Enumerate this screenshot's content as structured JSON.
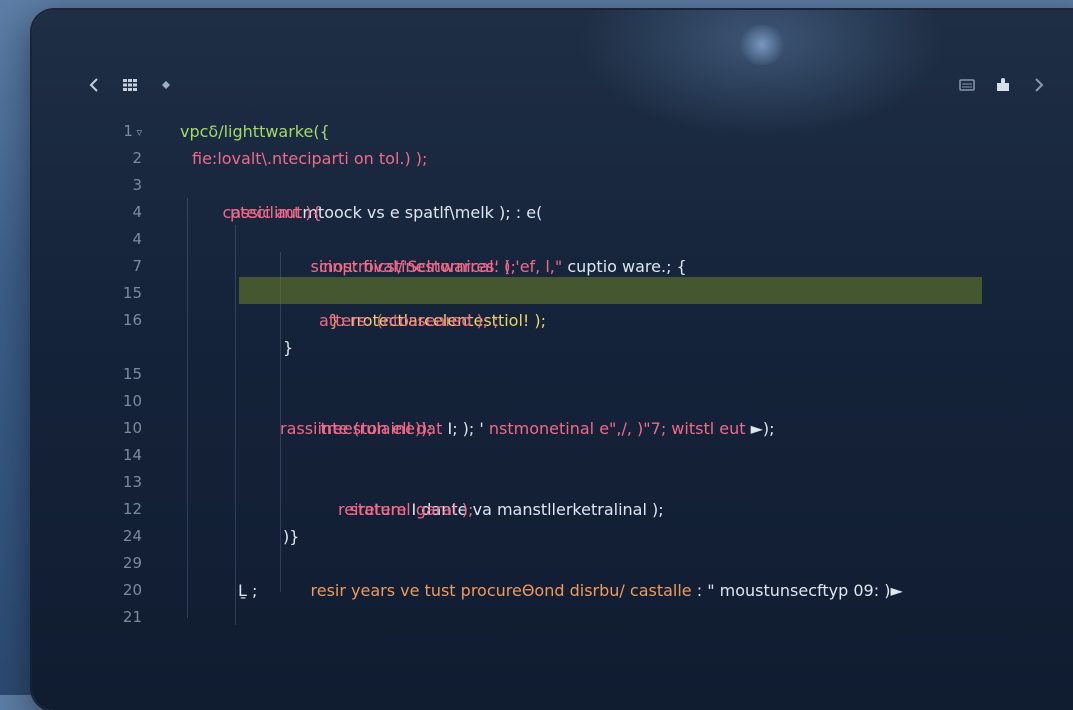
{
  "toolbar": {
    "left_icons": [
      "back-chevron-icon",
      "grid-icon",
      "dot-icon"
    ],
    "right_icons": [
      "panel-icon",
      "extension-icon",
      "forward-chevron-icon"
    ]
  },
  "editor": {
    "line_numbers": [
      "1",
      "2",
      "3",
      "4",
      "4",
      "7",
      "15",
      "16",
      "",
      "15",
      "10",
      "10",
      "14",
      "13",
      "12",
      "24",
      "29",
      "20",
      "21"
    ],
    "lines": {
      "l1": "vpcẟ/lighttwarke({",
      "l2": "fie:lovalt\\.nteciparti on tol.) );",
      "l3a": "cassic aut",
      "l3b": "mtoock vs e",
      "l3c": "spatlf\\melk ); : e(",
      "l4": "ptecilimt ){",
      "l5a": "sinostroval/'Sclnwarres' ( 'ef, l,\"",
      "l5b": " cuptio ware.; {",
      "l6": "cinμ: fiicstinestornical: );",
      "l7a": "}:",
      "l7b": " rrotectlarcelentesttiol! );",
      "l8": "atters: (ntosseared ); ;",
      "l9": "}",
      "l10a": "treeston ell dat",
      "l10b": " I; ); '",
      "l10c": " nstmonetinal e\",/, )\"7; witstl eut ",
      "l10d": "►);",
      "l11": "rassiinte (rulaine));",
      "l12a": "stature ",
      "l12b": "Ⅰ dante va manstllerketralinal );",
      "l13": "reireteml garal );",
      "l14": ")}",
      "l15a": "resir years ve tust procureΘond disrbu/ castalle",
      "l15b": " : \" moustunsecftyp 09: )►",
      "l16": "Ḻ ;"
    }
  },
  "colors": {
    "background": "#15233a",
    "highlight": "#5e7a28",
    "accent_pink": "#f06a8a",
    "accent_green": "#a6d86b"
  }
}
